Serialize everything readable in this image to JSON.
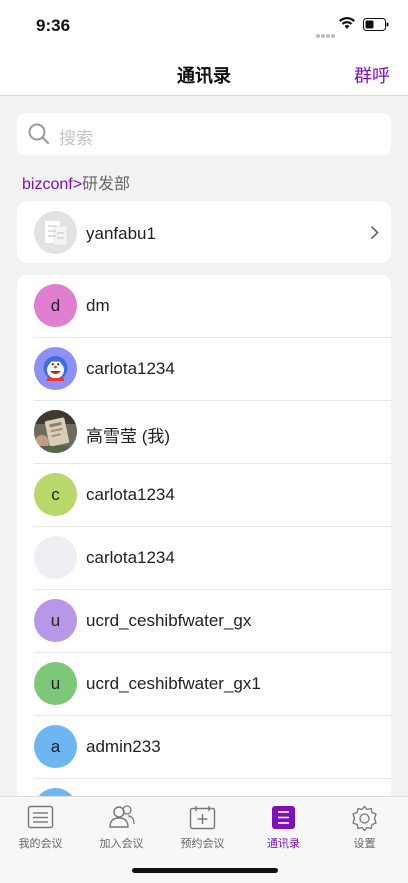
{
  "status_bar": {
    "time": "9:36"
  },
  "nav": {
    "title": "通讯录",
    "action": "群呼"
  },
  "search": {
    "placeholder": "搜索"
  },
  "breadcrumb": {
    "root": "bizconf",
    "separator": ">",
    "current": "研发部"
  },
  "department": {
    "name": "yanfabu1"
  },
  "contacts": [
    {
      "initial": "d",
      "name": "dm",
      "avatar_color": "#e07fd0",
      "avatar_type": "letter"
    },
    {
      "initial": "",
      "name": "carlota1234",
      "avatar_color": "#8e90f5",
      "avatar_type": "cartoon-image"
    },
    {
      "initial": "",
      "name": "高雪莹 (我)",
      "avatar_color": "#a89c8a",
      "avatar_type": "photo"
    },
    {
      "initial": "c",
      "name": "carlota1234",
      "avatar_color": "#b9d86a",
      "avatar_type": "letter"
    },
    {
      "initial": "",
      "name": "carlota1234",
      "avatar_color": "#efeff3",
      "avatar_type": "blank"
    },
    {
      "initial": "u",
      "name": "ucrd_ceshibfwater_gx",
      "avatar_color": "#b697e8",
      "avatar_type": "letter"
    },
    {
      "initial": "u",
      "name": "ucrd_ceshibfwater_gx1",
      "avatar_color": "#7dc878",
      "avatar_type": "letter"
    },
    {
      "initial": "a",
      "name": "admin233",
      "avatar_color": "#6db6f2",
      "avatar_type": "letter"
    },
    {
      "initial": "",
      "name": "",
      "avatar_color": "#6db6f2",
      "avatar_type": "letter"
    }
  ],
  "tabs": [
    {
      "label": "我的会议",
      "icon": "meeting-list-icon",
      "active": false
    },
    {
      "label": "加入会议",
      "icon": "join-meeting-icon",
      "active": false
    },
    {
      "label": "预约会议",
      "icon": "schedule-meeting-icon",
      "active": false
    },
    {
      "label": "通讯录",
      "icon": "contacts-icon",
      "active": true
    },
    {
      "label": "设置",
      "icon": "settings-gear-icon",
      "active": false
    }
  ],
  "colors": {
    "accent": "#7b12b8",
    "background": "#f2f2f4"
  }
}
